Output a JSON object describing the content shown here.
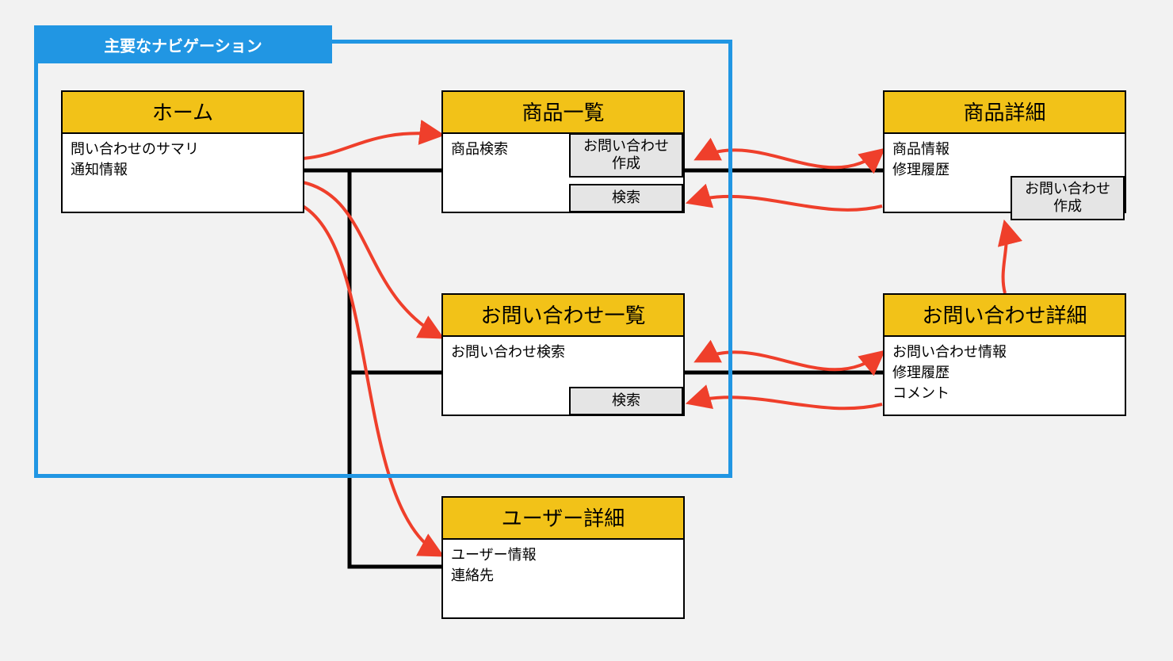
{
  "nav_group": {
    "label": "主要なナビゲーション"
  },
  "screens": {
    "home": {
      "title": "ホーム",
      "lines": [
        "問い合わせのサマリ",
        "通知情報"
      ]
    },
    "product_list": {
      "title": "商品一覧",
      "lines": [
        "商品検索"
      ]
    },
    "product_detail": {
      "title": "商品詳細",
      "lines": [
        "商品情報",
        "修理履歴"
      ]
    },
    "inquiry_list": {
      "title": "お問い合わせ一覧",
      "lines": [
        "お問い合わせ検索"
      ]
    },
    "inquiry_detail": {
      "title": "お問い合わせ詳細",
      "lines": [
        "お問い合わせ情報",
        "修理履歴",
        "コメント"
      ]
    },
    "user_detail": {
      "title": "ユーザー詳細",
      "lines": [
        "ユーザー情報",
        "連絡先"
      ]
    }
  },
  "chips": {
    "product_list_create": "お問い合わせ\n作成",
    "product_list_search": "検索",
    "product_detail_create": "お問い合わせ\n作成",
    "inquiry_list_search": "検索"
  }
}
